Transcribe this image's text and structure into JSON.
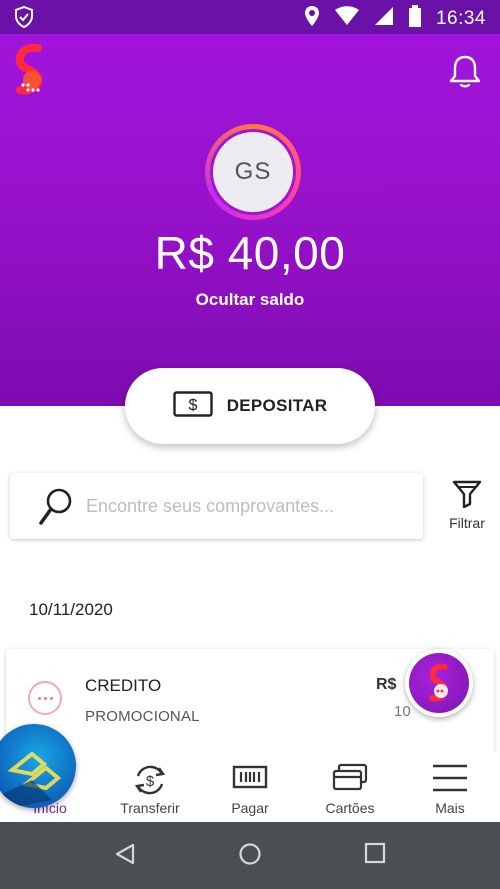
{
  "status_bar": {
    "time": "16:34",
    "icons": [
      "shield-check-icon",
      "location-icon",
      "wifi-icon",
      "signal-icon",
      "battery-icon"
    ]
  },
  "header": {
    "logo": "brand-logo",
    "notification_icon": "bell-icon",
    "avatar_initials": "GS",
    "balance": "R$ 40,00",
    "hide_balance_label": "Ocultar saldo",
    "gradient_colors": [
      "#a114dc",
      "#7d0cb0"
    ]
  },
  "deposit": {
    "label": "DEPOSITAR",
    "icon": "money-bill-icon"
  },
  "search": {
    "placeholder": "Encontre seus comprovantes...",
    "value": "",
    "icon": "magnifier-icon"
  },
  "filter": {
    "label": "Filtrar",
    "icon": "funnel-icon"
  },
  "transactions": {
    "date": "10/11/2020",
    "items": [
      {
        "title": "CREDITO",
        "subtitle": "PROMOCIONAL",
        "amount": "R$",
        "time": "10",
        "icon": "more-dots-icon"
      }
    ]
  },
  "bottom_nav": {
    "items": [
      {
        "label": "Início",
        "icon": "home-icon",
        "active": true
      },
      {
        "label": "Transferir",
        "icon": "transfer-icon"
      },
      {
        "label": "Pagar",
        "icon": "barcode-icon"
      },
      {
        "label": "Cartões",
        "icon": "cards-icon"
      },
      {
        "label": "Mais",
        "icon": "menu-icon"
      }
    ],
    "active_color": "#7b1fa2"
  },
  "android_nav": {
    "icons": [
      "back-icon",
      "home-circle-icon",
      "recents-icon"
    ]
  }
}
